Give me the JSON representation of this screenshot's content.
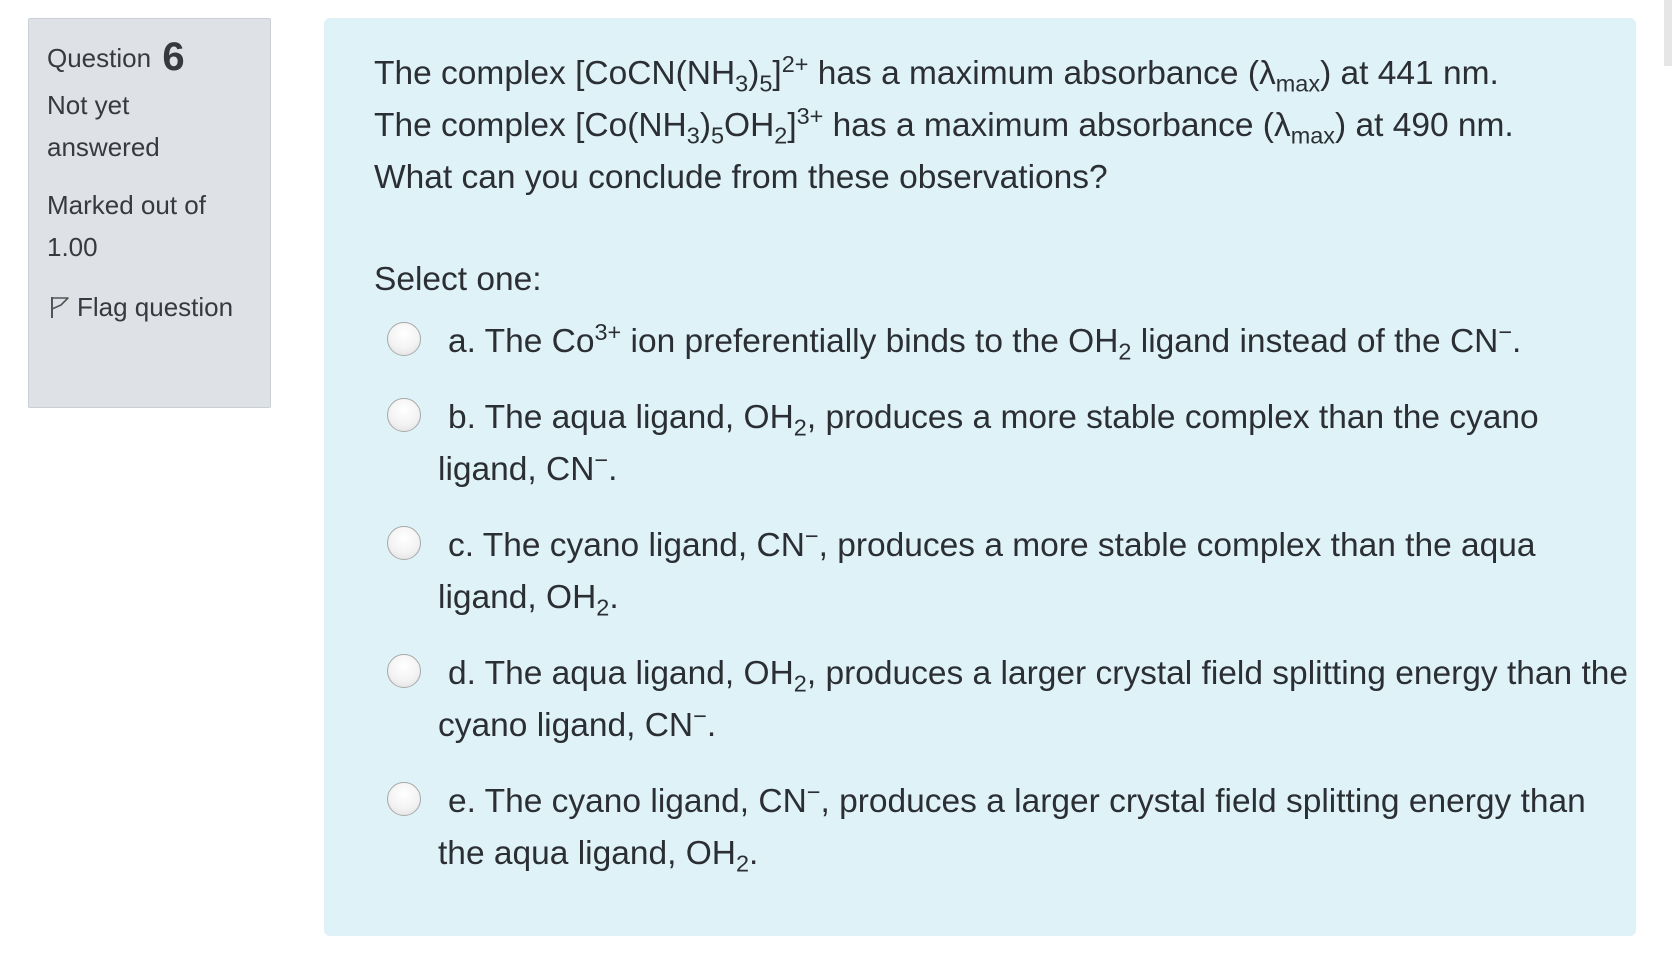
{
  "info": {
    "question_label": "Question",
    "question_number": "6",
    "state": "Not yet answered",
    "grade": "Marked out of 1.00",
    "flag_label": "Flag question"
  },
  "question": {
    "line1": {
      "a": "The complex [CoCN(NH",
      "s1": "3",
      "b": ")",
      "s2": "5",
      "c": "]",
      "sup": "2+",
      "d": " has a maximum absorbance (λ",
      "s3": "max",
      "e": ") at 441 nm."
    },
    "line2": {
      "a": "The complex [Co(NH",
      "s1": "3",
      "b": ")",
      "s2": "5",
      "c": "OH",
      "s3": "2",
      "d": "]",
      "sup": "3+",
      "e": " has a maximum absorbance (λ",
      "s4": "max",
      "f": ") at 490 nm."
    },
    "line3": "What can you conclude from these observations?",
    "prompt": "Select one:"
  },
  "options": {
    "a": {
      "t1": "a. The Co",
      "sup": "3+",
      "t2": " ion preferentially binds to the OH",
      "sub": "2",
      "t3": " ligand instead of the CN",
      "sup2": "−",
      "t4": "."
    },
    "b": {
      "t1": "b. The aqua ligand, OH",
      "sub": "2",
      "t2": ", produces a more stable complex than the cyano ligand, CN",
      "sup": "−",
      "t3": "."
    },
    "c": {
      "t1": "c. The cyano ligand, CN",
      "sup": "−",
      "t2": ", produces a more stable complex than the aqua ligand, OH",
      "sub": "2",
      "t3": "."
    },
    "d": {
      "t1": "d. The aqua ligand, OH",
      "sub": "2",
      "t2": ", produces a larger crystal field splitting energy than the cyano ligand, CN",
      "sup": "−",
      "t3": "."
    },
    "e": {
      "t1": "e. The cyano ligand, CN",
      "sup": "−",
      "t2": ", produces a larger crystal field splitting energy than the aqua ligand, OH",
      "sub": "2",
      "t3": "."
    }
  },
  "icons": {
    "flag": "flag-outline-icon",
    "radio": "radio-unchecked"
  },
  "colors": {
    "info_bg": "#dee2e6",
    "content_bg": "#def2f8",
    "text": "#373a3c"
  }
}
